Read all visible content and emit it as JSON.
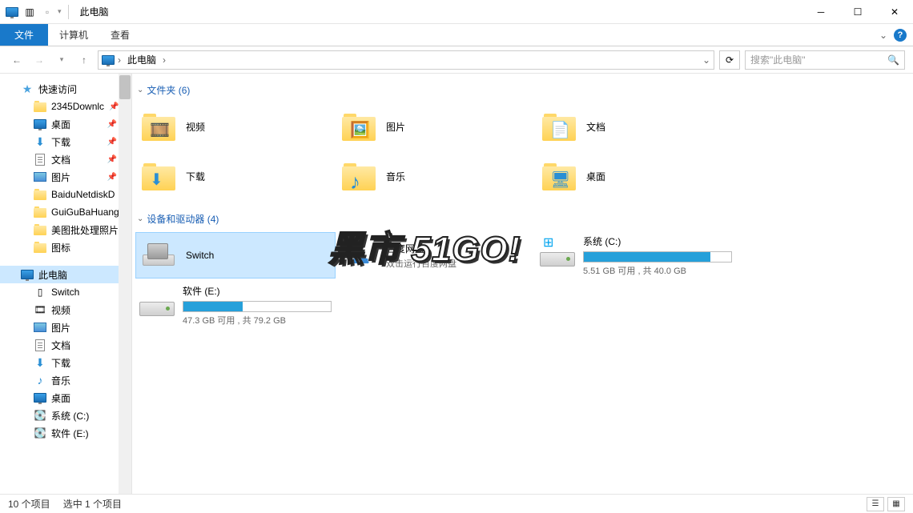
{
  "window": {
    "title": "此电脑"
  },
  "ribbon": {
    "file": "文件",
    "tabs": [
      "计算机",
      "查看"
    ]
  },
  "breadcrumb": {
    "root": "此电脑"
  },
  "search": {
    "placeholder": "搜索\"此电脑\""
  },
  "sidebar": {
    "quick_access": "快速访问",
    "quick_items": [
      {
        "label": "2345Downlc",
        "icon": "folder",
        "pinned": true
      },
      {
        "label": "桌面",
        "icon": "monitor",
        "pinned": true
      },
      {
        "label": "下载",
        "icon": "download",
        "pinned": true
      },
      {
        "label": "文档",
        "icon": "doc",
        "pinned": true
      },
      {
        "label": "图片",
        "icon": "picture",
        "pinned": true
      },
      {
        "label": "BaiduNetdiskD",
        "icon": "folder",
        "pinned": false
      },
      {
        "label": "GuiGuBaHuang",
        "icon": "folder",
        "pinned": false
      },
      {
        "label": "美图批处理照片",
        "icon": "folder",
        "pinned": false
      },
      {
        "label": "图标",
        "icon": "folder",
        "pinned": false
      }
    ],
    "this_pc": "此电脑",
    "pc_items": [
      {
        "label": "Switch",
        "icon": "drive"
      },
      {
        "label": "视频",
        "icon": "video"
      },
      {
        "label": "图片",
        "icon": "picture"
      },
      {
        "label": "文档",
        "icon": "doc"
      },
      {
        "label": "下载",
        "icon": "download"
      },
      {
        "label": "音乐",
        "icon": "music"
      },
      {
        "label": "桌面",
        "icon": "monitor"
      },
      {
        "label": "系统 (C:)",
        "icon": "disk"
      },
      {
        "label": "软件 (E:)",
        "icon": "disk"
      }
    ]
  },
  "groups": {
    "folders": {
      "title": "文件夹 (6)",
      "items": [
        {
          "label": "视频",
          "overlay": "🎞️"
        },
        {
          "label": "图片",
          "overlay": "🖼️"
        },
        {
          "label": "文档",
          "overlay": "📄"
        },
        {
          "label": "下载",
          "overlay": "⬇"
        },
        {
          "label": "音乐",
          "overlay": "♪"
        },
        {
          "label": "桌面",
          "overlay": "🖥"
        }
      ]
    },
    "devices": {
      "title": "设备和驱动器 (4)",
      "items": [
        {
          "label": "Switch",
          "type": "drive",
          "selected": true
        },
        {
          "label": "百度网盘",
          "type": "app",
          "sub": "双击运行百度网盘"
        },
        {
          "label": "系统 (C:)",
          "type": "disk",
          "free": "5.51 GB 可用 , 共 40.0 GB",
          "pct": 86,
          "winlogo": true
        },
        {
          "label": "软件 (E:)",
          "type": "disk",
          "free": "47.3 GB 可用 , 共 79.2 GB",
          "pct": 40
        }
      ]
    }
  },
  "status": {
    "count": "10 个项目",
    "selected": "选中 1 个项目"
  },
  "watermark": "黑市 51GO!"
}
